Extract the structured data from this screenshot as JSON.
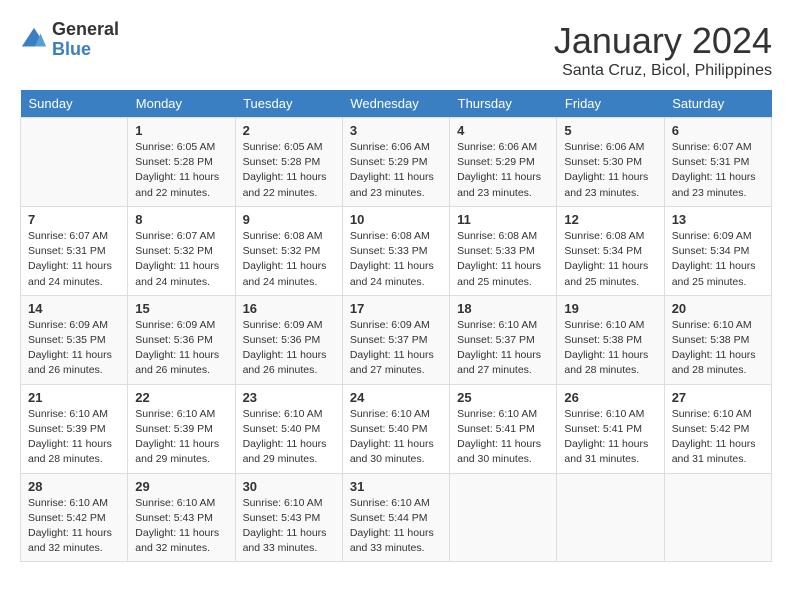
{
  "logo": {
    "general": "General",
    "blue": "Blue"
  },
  "title": "January 2024",
  "location": "Santa Cruz, Bicol, Philippines",
  "days_header": [
    "Sunday",
    "Monday",
    "Tuesday",
    "Wednesday",
    "Thursday",
    "Friday",
    "Saturday"
  ],
  "weeks": [
    [
      {
        "day": "",
        "info": ""
      },
      {
        "day": "1",
        "info": "Sunrise: 6:05 AM\nSunset: 5:28 PM\nDaylight: 11 hours\nand 22 minutes."
      },
      {
        "day": "2",
        "info": "Sunrise: 6:05 AM\nSunset: 5:28 PM\nDaylight: 11 hours\nand 22 minutes."
      },
      {
        "day": "3",
        "info": "Sunrise: 6:06 AM\nSunset: 5:29 PM\nDaylight: 11 hours\nand 23 minutes."
      },
      {
        "day": "4",
        "info": "Sunrise: 6:06 AM\nSunset: 5:29 PM\nDaylight: 11 hours\nand 23 minutes."
      },
      {
        "day": "5",
        "info": "Sunrise: 6:06 AM\nSunset: 5:30 PM\nDaylight: 11 hours\nand 23 minutes."
      },
      {
        "day": "6",
        "info": "Sunrise: 6:07 AM\nSunset: 5:31 PM\nDaylight: 11 hours\nand 23 minutes."
      }
    ],
    [
      {
        "day": "7",
        "info": "Sunrise: 6:07 AM\nSunset: 5:31 PM\nDaylight: 11 hours\nand 24 minutes."
      },
      {
        "day": "8",
        "info": "Sunrise: 6:07 AM\nSunset: 5:32 PM\nDaylight: 11 hours\nand 24 minutes."
      },
      {
        "day": "9",
        "info": "Sunrise: 6:08 AM\nSunset: 5:32 PM\nDaylight: 11 hours\nand 24 minutes."
      },
      {
        "day": "10",
        "info": "Sunrise: 6:08 AM\nSunset: 5:33 PM\nDaylight: 11 hours\nand 24 minutes."
      },
      {
        "day": "11",
        "info": "Sunrise: 6:08 AM\nSunset: 5:33 PM\nDaylight: 11 hours\nand 25 minutes."
      },
      {
        "day": "12",
        "info": "Sunrise: 6:08 AM\nSunset: 5:34 PM\nDaylight: 11 hours\nand 25 minutes."
      },
      {
        "day": "13",
        "info": "Sunrise: 6:09 AM\nSunset: 5:34 PM\nDaylight: 11 hours\nand 25 minutes."
      }
    ],
    [
      {
        "day": "14",
        "info": "Sunrise: 6:09 AM\nSunset: 5:35 PM\nDaylight: 11 hours\nand 26 minutes."
      },
      {
        "day": "15",
        "info": "Sunrise: 6:09 AM\nSunset: 5:36 PM\nDaylight: 11 hours\nand 26 minutes."
      },
      {
        "day": "16",
        "info": "Sunrise: 6:09 AM\nSunset: 5:36 PM\nDaylight: 11 hours\nand 26 minutes."
      },
      {
        "day": "17",
        "info": "Sunrise: 6:09 AM\nSunset: 5:37 PM\nDaylight: 11 hours\nand 27 minutes."
      },
      {
        "day": "18",
        "info": "Sunrise: 6:10 AM\nSunset: 5:37 PM\nDaylight: 11 hours\nand 27 minutes."
      },
      {
        "day": "19",
        "info": "Sunrise: 6:10 AM\nSunset: 5:38 PM\nDaylight: 11 hours\nand 28 minutes."
      },
      {
        "day": "20",
        "info": "Sunrise: 6:10 AM\nSunset: 5:38 PM\nDaylight: 11 hours\nand 28 minutes."
      }
    ],
    [
      {
        "day": "21",
        "info": "Sunrise: 6:10 AM\nSunset: 5:39 PM\nDaylight: 11 hours\nand 28 minutes."
      },
      {
        "day": "22",
        "info": "Sunrise: 6:10 AM\nSunset: 5:39 PM\nDaylight: 11 hours\nand 29 minutes."
      },
      {
        "day": "23",
        "info": "Sunrise: 6:10 AM\nSunset: 5:40 PM\nDaylight: 11 hours\nand 29 minutes."
      },
      {
        "day": "24",
        "info": "Sunrise: 6:10 AM\nSunset: 5:40 PM\nDaylight: 11 hours\nand 30 minutes."
      },
      {
        "day": "25",
        "info": "Sunrise: 6:10 AM\nSunset: 5:41 PM\nDaylight: 11 hours\nand 30 minutes."
      },
      {
        "day": "26",
        "info": "Sunrise: 6:10 AM\nSunset: 5:41 PM\nDaylight: 11 hours\nand 31 minutes."
      },
      {
        "day": "27",
        "info": "Sunrise: 6:10 AM\nSunset: 5:42 PM\nDaylight: 11 hours\nand 31 minutes."
      }
    ],
    [
      {
        "day": "28",
        "info": "Sunrise: 6:10 AM\nSunset: 5:42 PM\nDaylight: 11 hours\nand 32 minutes."
      },
      {
        "day": "29",
        "info": "Sunrise: 6:10 AM\nSunset: 5:43 PM\nDaylight: 11 hours\nand 32 minutes."
      },
      {
        "day": "30",
        "info": "Sunrise: 6:10 AM\nSunset: 5:43 PM\nDaylight: 11 hours\nand 33 minutes."
      },
      {
        "day": "31",
        "info": "Sunrise: 6:10 AM\nSunset: 5:44 PM\nDaylight: 11 hours\nand 33 minutes."
      },
      {
        "day": "",
        "info": ""
      },
      {
        "day": "",
        "info": ""
      },
      {
        "day": "",
        "info": ""
      }
    ]
  ]
}
